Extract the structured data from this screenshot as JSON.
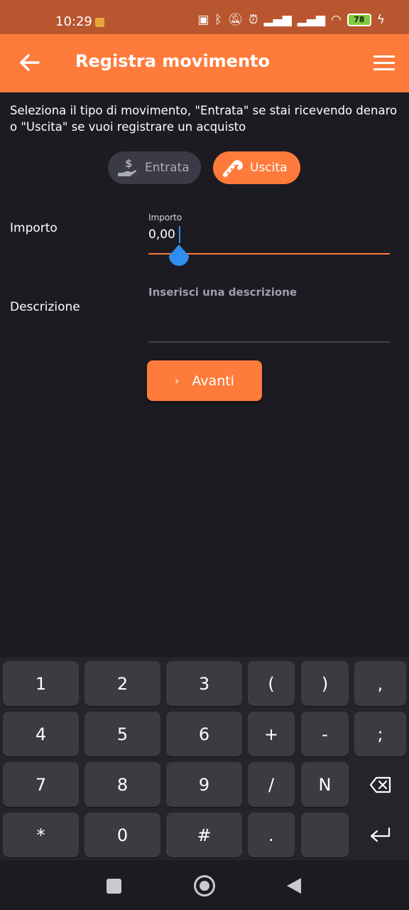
{
  "status_bar": {
    "time": "10:29",
    "battery": "78"
  },
  "app_bar": {
    "title": "Registra movimento",
    "back_icon": "arrow-left-icon",
    "menu_icon": "hamburger-menu-icon"
  },
  "intro_text": "Seleziona il tipo di movimento, \"Entrata\" se stai ricevendo denaro o \"Uscita\" se vuoi registrare un acquisto",
  "type_toggle": {
    "entrata_label": "Entrata",
    "uscita_label": "Uscita",
    "selected": "Uscita"
  },
  "form": {
    "importo_label": "Importo",
    "importo_floating_label": "Importo",
    "importo_value": "0,00",
    "descrizione_label": "Descrizione",
    "descrizione_placeholder": "Inserisci una descrizione"
  },
  "next_button": {
    "label": "Avanti"
  },
  "keyboard": {
    "rows": [
      [
        "1",
        "2",
        "3",
        "(",
        ")",
        ","
      ],
      [
        "4",
        "5",
        "6",
        "+",
        "-",
        ";"
      ],
      [
        "7",
        "8",
        "9",
        "/",
        "N",
        "⌫"
      ],
      [
        "*",
        "0",
        "#",
        ".",
        "",
        "↵"
      ]
    ]
  },
  "colors": {
    "accent": "#ff7b3c",
    "background": "#1c1b22",
    "status_bar": "#b8562f",
    "cursor": "#2f8ff0"
  }
}
